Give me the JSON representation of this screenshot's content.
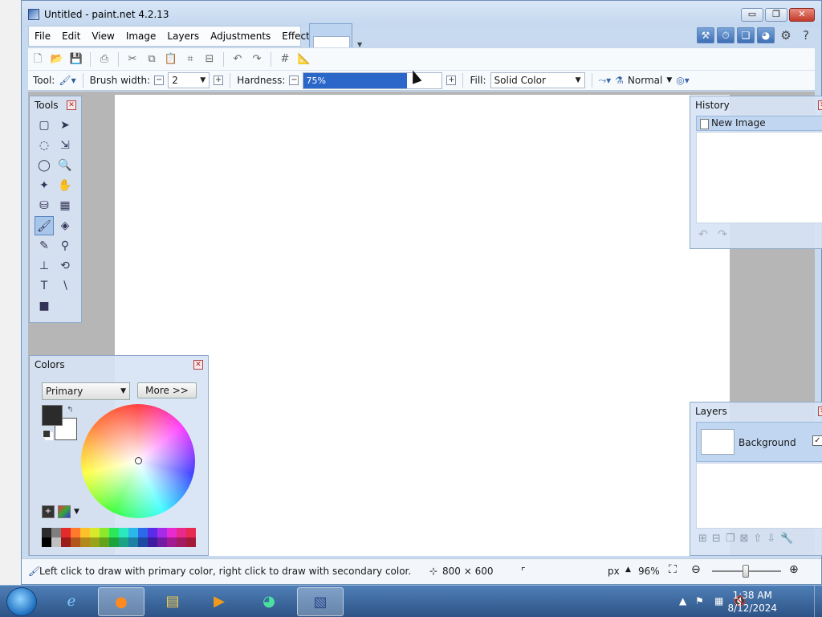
{
  "window": {
    "title": "Untitled - paint.net 4.2.13",
    "controls": {
      "minimize": "▭",
      "restore": "❐",
      "close": "✕"
    }
  },
  "menu": [
    "File",
    "Edit",
    "View",
    "Image",
    "Layers",
    "Adjustments",
    "Effects"
  ],
  "toolbar": {
    "tool_label": "Tool:",
    "brush_width_label": "Brush width:",
    "brush_width_value": "2",
    "hardness_label": "Hardness:",
    "hardness_value": "75%",
    "hardness_fraction": 0.75,
    "fill_label": "Fill:",
    "fill_value": "Solid Color",
    "blend_mode": "Normal"
  },
  "tools_panel": {
    "title": "Tools",
    "tools": [
      {
        "name": "rectangle-select-tool",
        "glyph": "▢"
      },
      {
        "name": "move-selection-tool",
        "glyph": "➤"
      },
      {
        "name": "lasso-select-tool",
        "glyph": "◌"
      },
      {
        "name": "move-selected-tool",
        "glyph": "⇲"
      },
      {
        "name": "ellipse-select-tool",
        "glyph": "◯"
      },
      {
        "name": "zoom-tool",
        "glyph": "🔍"
      },
      {
        "name": "magic-wand-tool",
        "glyph": "✦"
      },
      {
        "name": "pan-tool",
        "glyph": "✋"
      },
      {
        "name": "paint-bucket-tool",
        "glyph": "⛁"
      },
      {
        "name": "gradient-tool",
        "glyph": "▦"
      },
      {
        "name": "paintbrush-tool",
        "glyph": "🖌"
      },
      {
        "name": "eraser-tool",
        "glyph": "◈"
      },
      {
        "name": "pencil-tool",
        "glyph": "✎"
      },
      {
        "name": "color-picker-tool",
        "glyph": "⚲"
      },
      {
        "name": "clone-stamp-tool",
        "glyph": "⊥"
      },
      {
        "name": "recolor-tool",
        "glyph": "⟲"
      },
      {
        "name": "text-tool",
        "glyph": "T"
      },
      {
        "name": "line-curve-tool",
        "glyph": "∖"
      },
      {
        "name": "shapes-tool",
        "glyph": "■"
      }
    ]
  },
  "colors_panel": {
    "title": "Colors",
    "mode": "Primary",
    "more_button": "More >>",
    "primary_color": "#2b2b2b",
    "secondary_color": "#ffffff",
    "palette": [
      "#2b2b2b",
      "#7f7f7f",
      "#e32b2b",
      "#ff7a2b",
      "#ffc12b",
      "#d8e82b",
      "#8ce82b",
      "#2be85a",
      "#2be8c1",
      "#2bb7e8",
      "#2b6ae8",
      "#5a2be8",
      "#a62be8",
      "#e82bd0",
      "#e82b8a",
      "#e82b50",
      "#000000",
      "#bfbfbf",
      "#9b1b1b",
      "#b2541b",
      "#b28a1b",
      "#98a31b",
      "#62a31b",
      "#1ba33e",
      "#1ba387",
      "#1b80a3",
      "#1b4aa3",
      "#3e1ba3",
      "#741ba3",
      "#a31b92",
      "#a31b60",
      "#a31b38"
    ]
  },
  "history_panel": {
    "title": "History",
    "items": [
      "New Image"
    ],
    "undo_redo": "↶ ↷"
  },
  "layers_panel": {
    "title": "Layers",
    "layers": [
      {
        "name": "Background",
        "visible": "✓"
      }
    ]
  },
  "status": {
    "hint": "Left click to draw with primary color, right click to draw with secondary color.",
    "image_size": "800 × 600",
    "units": "px",
    "zoom": "96%"
  },
  "taskbar": {
    "time": "1:38 AM",
    "date": "8/12/2024"
  }
}
